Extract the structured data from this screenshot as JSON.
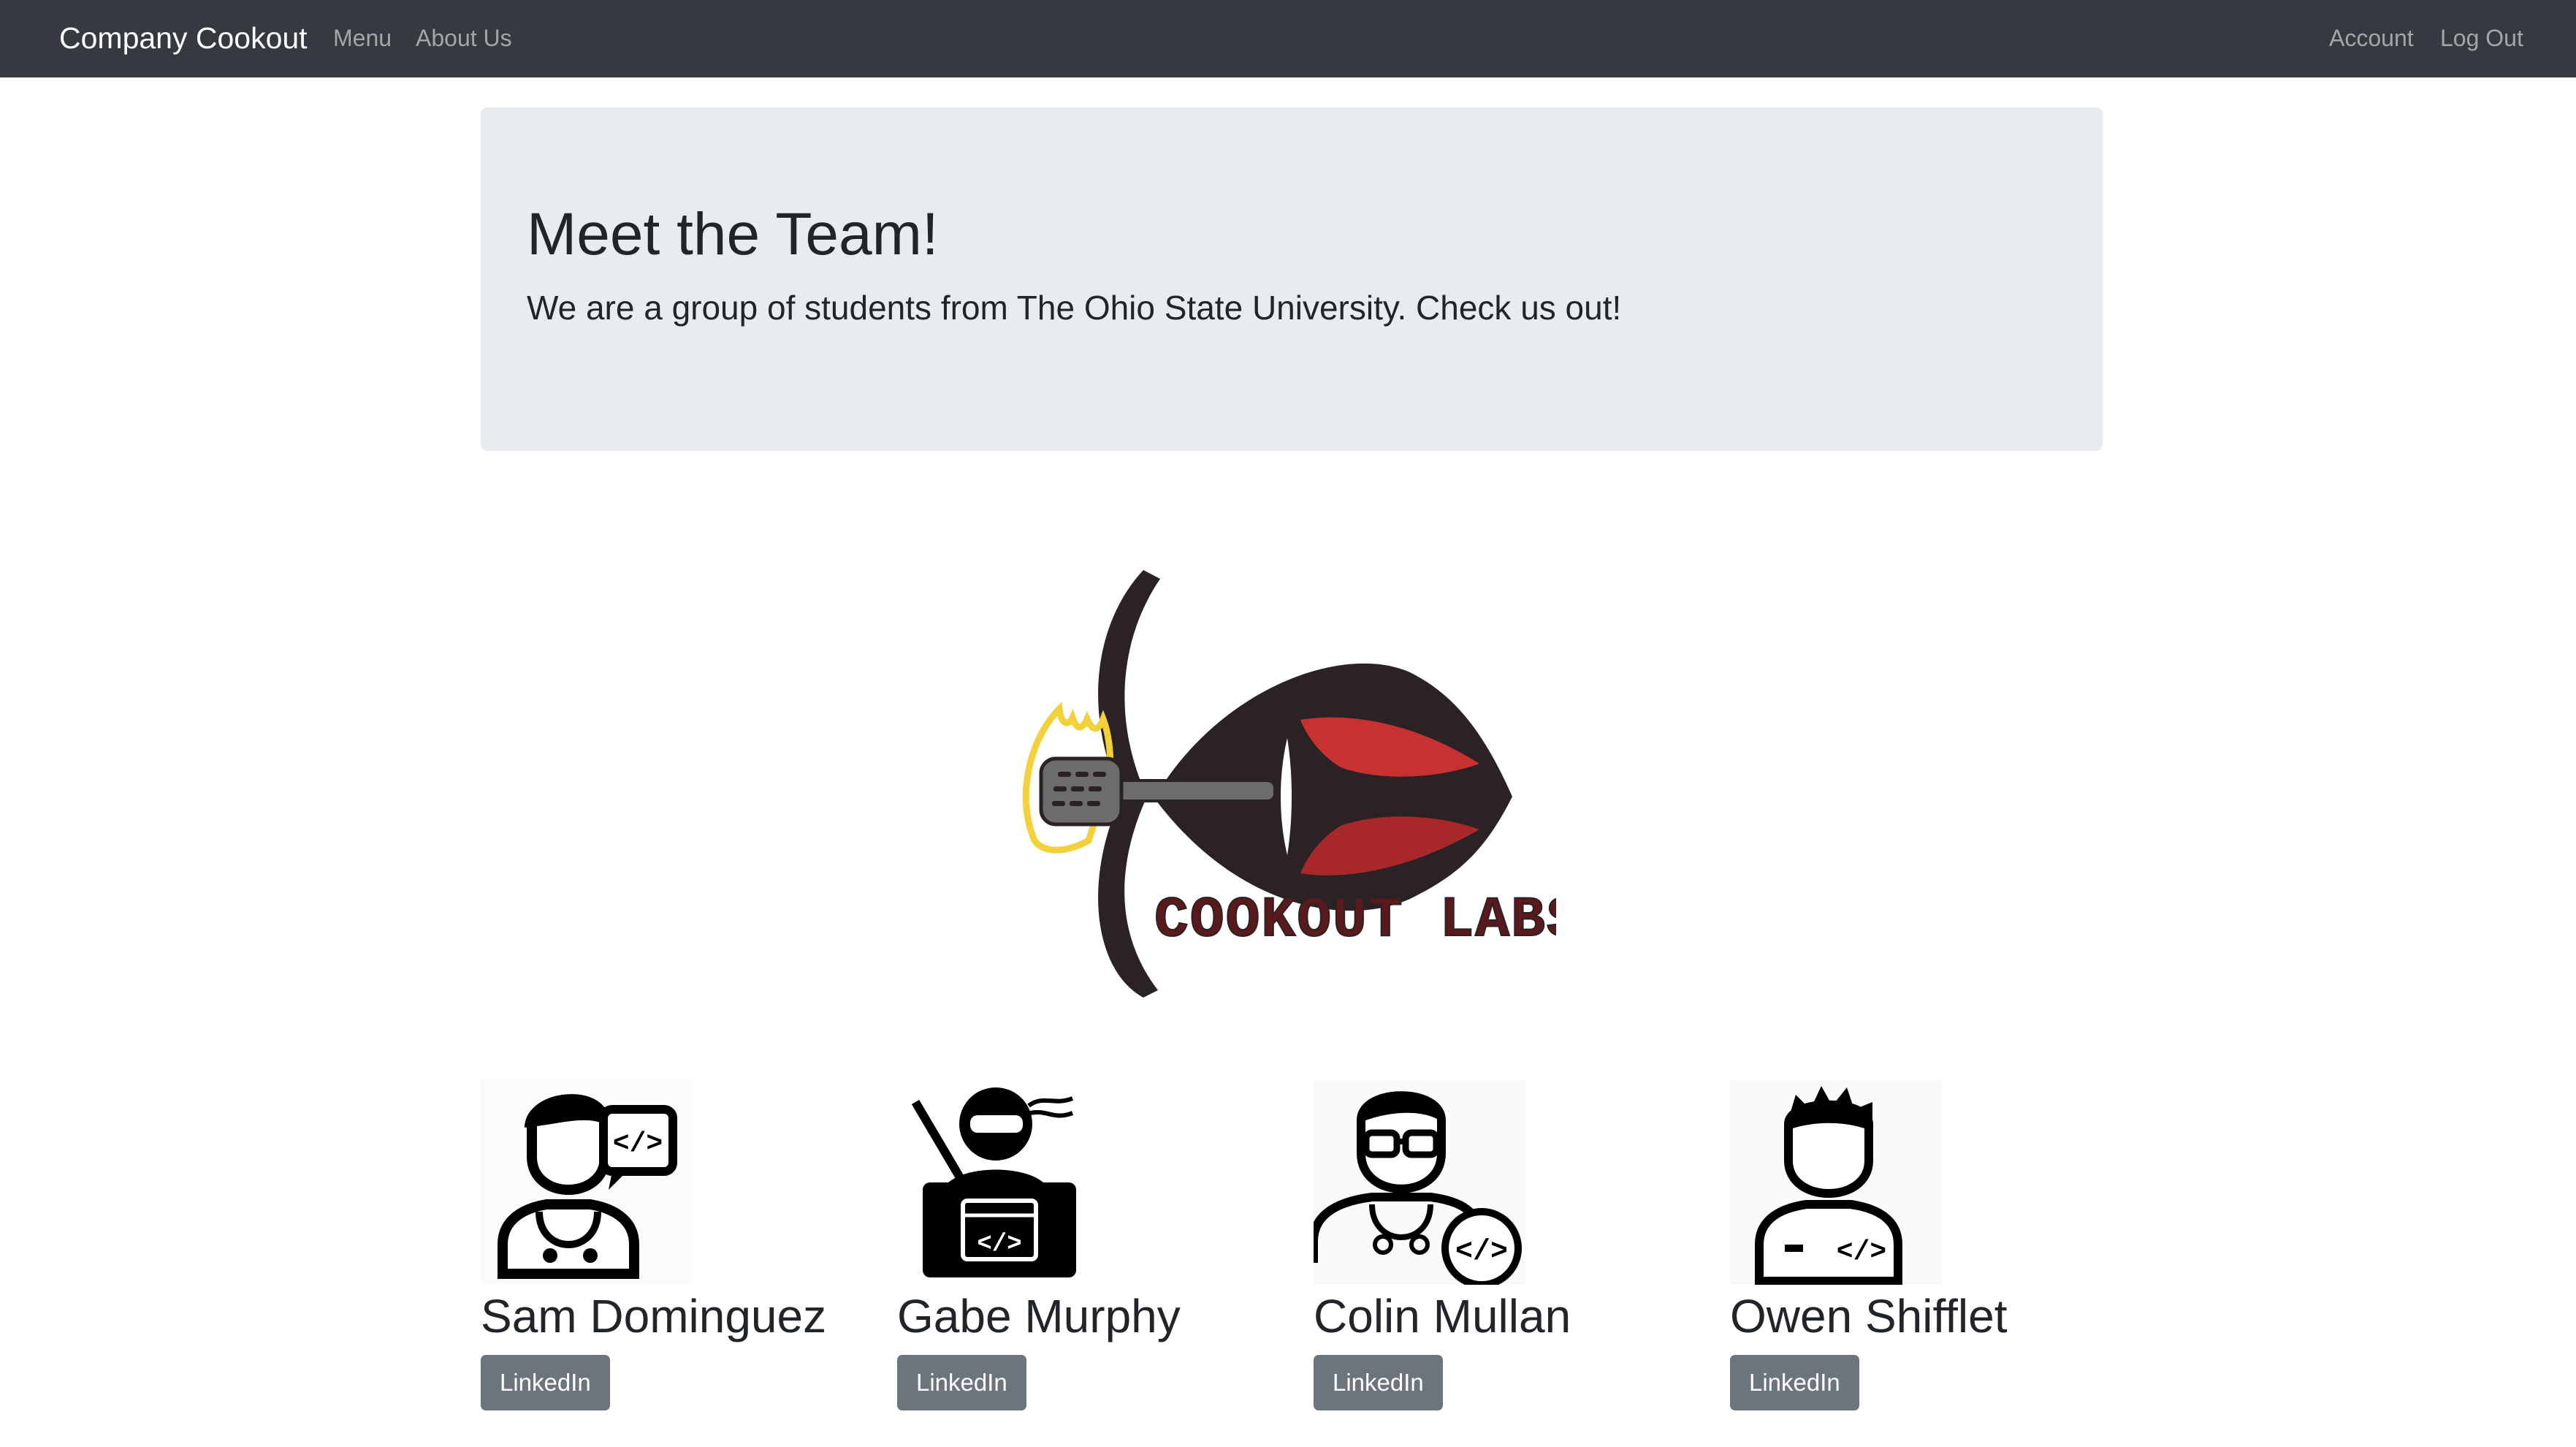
{
  "navbar": {
    "brand": "Company Cookout",
    "left_links": [
      "Menu",
      "About Us"
    ],
    "right_links": [
      "Account",
      "Log Out"
    ]
  },
  "jumbotron": {
    "title": "Meet the Team!",
    "lead": "We are a group of students from The Ohio State University. Check us out!"
  },
  "logo": {
    "text": "COOKOUT LABS",
    "colors": {
      "dark": "#2a2225",
      "red": "#c8312f",
      "yellow": "#f2d13a",
      "gray": "#6c6c6c"
    }
  },
  "team": [
    {
      "name": "Sam Dominguez",
      "button": "LinkedIn",
      "icon": "developer-speech-bubble-icon"
    },
    {
      "name": "Gabe Murphy",
      "button": "LinkedIn",
      "icon": "ninja-laptop-icon"
    },
    {
      "name": "Colin Mullan",
      "button": "LinkedIn",
      "icon": "developer-glasses-icon"
    },
    {
      "name": "Owen Shifflet",
      "button": "LinkedIn",
      "icon": "developer-shirt-code-icon"
    }
  ],
  "colors": {
    "navbar_bg": "#343a40",
    "jumbotron_bg": "#e9ecef",
    "button_bg": "#6c757d"
  }
}
